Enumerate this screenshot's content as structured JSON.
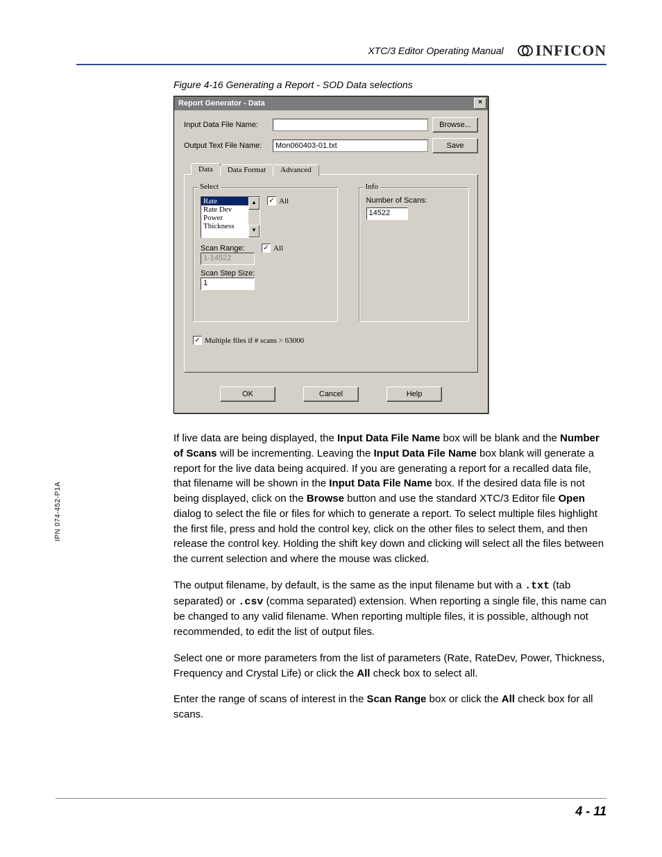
{
  "header": {
    "manual_title": "XTC/3 Editor Operating Manual",
    "logo_text": "INFICON"
  },
  "figure_caption": "Figure 4-16  Generating a Report - SOD Data selections",
  "dialog": {
    "title": "Report Generator - Data",
    "close_glyph": "×",
    "input_file_label": "Input Data File Name:",
    "input_file_value": "",
    "browse_label": "Browse...",
    "output_file_label": "Output Text File Name:",
    "output_file_value": "Mon060403-01.txt",
    "save_label": "Save",
    "tabs": [
      "Data",
      "Data Format",
      "Advanced"
    ],
    "select_group": {
      "legend": "Select",
      "options": [
        "Rate",
        "Rate Dev",
        "Power",
        "Thickness"
      ],
      "all_checkbox": "All",
      "scan_range_label": "Scan Range:",
      "scan_range_value": "1-14522",
      "scan_range_all": "All",
      "scan_step_label": "Scan Step Size:",
      "scan_step_value": "1"
    },
    "info_group": {
      "legend": "Info",
      "number_scans_label": "Number of Scans:",
      "number_scans_value": "14522"
    },
    "multiple_files_label": "Multiple files if # scans > 63000",
    "buttons": {
      "ok": "OK",
      "cancel": "Cancel",
      "help": "Help"
    }
  },
  "paragraphs": {
    "p1_a": "If live data are being displayed, the ",
    "p1_b": "Input Data File Name",
    "p1_c": " box will be blank and the ",
    "p1_d": "Number of Scans",
    "p1_e": " will be incrementing. Leaving the ",
    "p1_f": "Input Data File Name",
    "p1_g": " box blank will generate a report for the live data being acquired. If you are generating a report for a recalled data file, that filename will be shown in the ",
    "p1_h": "Input Data File Name",
    "p1_i": " box. If the desired data file is not being displayed, click on the ",
    "p1_j": "Browse",
    "p1_k": " button and use the standard XTC/3 Editor file ",
    "p1_l": "Open",
    "p1_m": " dialog to select the file or files for which to generate a report. To select multiple files highlight the first file, press and hold the control key, click on the other files to select them, and then release the control key. Holding the shift key down and clicking will select all the files between the current selection and where the mouse was clicked.",
    "p2_a": "The output filename, by default, is the same as the input filename but with a ",
    "p2_b": ".txt",
    "p2_c": " (tab separated) or ",
    "p2_d": ".csv",
    "p2_e": " (comma separated) extension. When reporting a single file, this name can be changed to any valid filename. When reporting multiple files, it is possible, although not recommended, to edit the list of output files.",
    "p3_a": "Select one or more parameters from the list of parameters (Rate, RateDev, Power, Thickness, Frequency and Crystal Life) or click the ",
    "p3_b": "All",
    "p3_c": " check box to select all.",
    "p4_a": "Enter the range of scans of interest in the ",
    "p4_b": "Scan Range",
    "p4_c": " box or click the ",
    "p4_d": "All",
    "p4_e": " check box for all scans."
  },
  "side_ipn": "IPN 074-452-P1A",
  "page_number": "4 - 11"
}
